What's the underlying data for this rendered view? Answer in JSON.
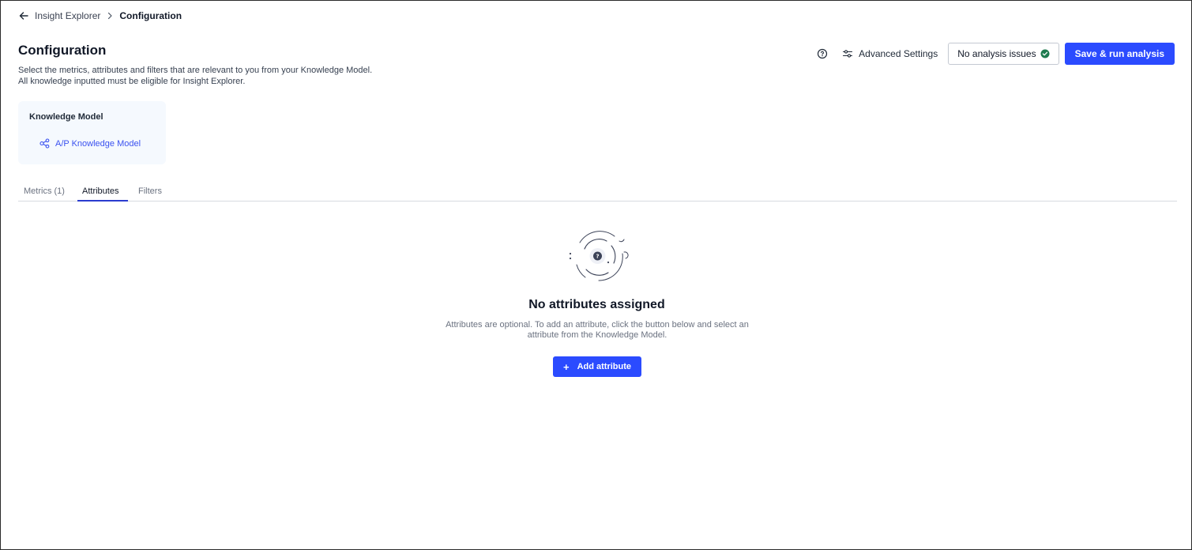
{
  "breadcrumb": {
    "parent": "Insight Explorer",
    "current": "Configuration"
  },
  "header": {
    "title": "Configuration",
    "description": "Select the metrics, attributes and filters that are relevant to you from your Knowledge Model. All knowledge inputted must be eligible for Insight Explorer."
  },
  "actions": {
    "advanced_settings": "Advanced Settings",
    "analysis_status": "No analysis issues",
    "save_run": "Save & run analysis"
  },
  "knowledge_model": {
    "label": "Knowledge Model",
    "link": "A/P Knowledge Model"
  },
  "tabs": [
    {
      "label": "Metrics (1)",
      "active": false
    },
    {
      "label": "Attributes",
      "active": true
    },
    {
      "label": "Filters",
      "active": false
    }
  ],
  "empty_state": {
    "title": "No attributes assigned",
    "description": "Attributes are optional. To add an attribute, click the button below and select an attribute from the Knowledge Model.",
    "button_icon": "+",
    "button_label": "Add attribute"
  },
  "colors": {
    "primary": "#2b4bff",
    "success": "#1e7b4f",
    "card_bg": "#f5f9fe",
    "link": "#3b52f0"
  },
  "icons": {
    "back": "arrow-left-icon",
    "separator": "chevron-right-icon",
    "help": "question-circle-icon",
    "settings": "sliders-icon",
    "status": "check-circle-icon",
    "knowledge_model": "share-nodes-icon",
    "empty": "question-orbit-icon"
  }
}
